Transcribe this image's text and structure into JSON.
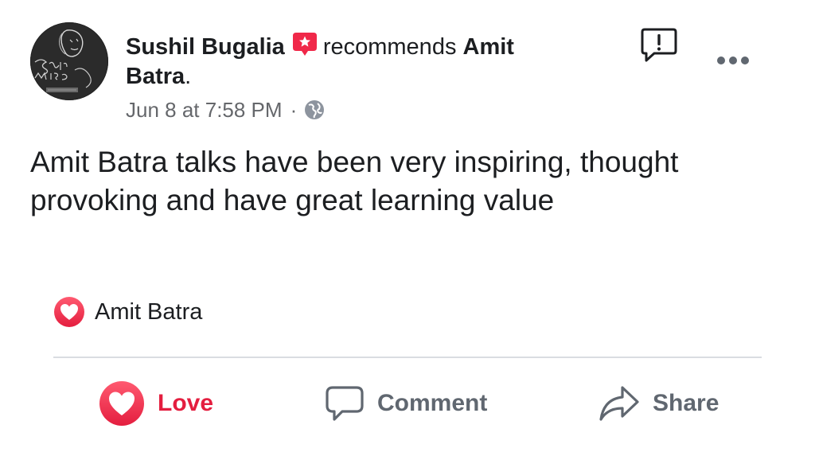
{
  "post": {
    "author": "Sushil Bugalia",
    "verb": "recommends",
    "page_name_line1": "Amit",
    "page_name_line2": "Batra",
    "page_name_suffix": ".",
    "timestamp": "Jun 8 at 7:58 PM",
    "separator": "·",
    "privacy_icon": "globe-icon",
    "text": "Amit Batra talks have been very inspiring, thought provoking and have great learning value"
  },
  "reactions": {
    "icon": "love-reaction-icon",
    "names": "Amit Batra"
  },
  "actions": {
    "love_label": "Love",
    "comment_label": "Comment",
    "share_label": "Share"
  },
  "colors": {
    "love_red": "#e41e3f",
    "text": "#1c1e21",
    "secondary": "#65676b",
    "action_gray": "#606770",
    "divider": "#dadde1"
  }
}
